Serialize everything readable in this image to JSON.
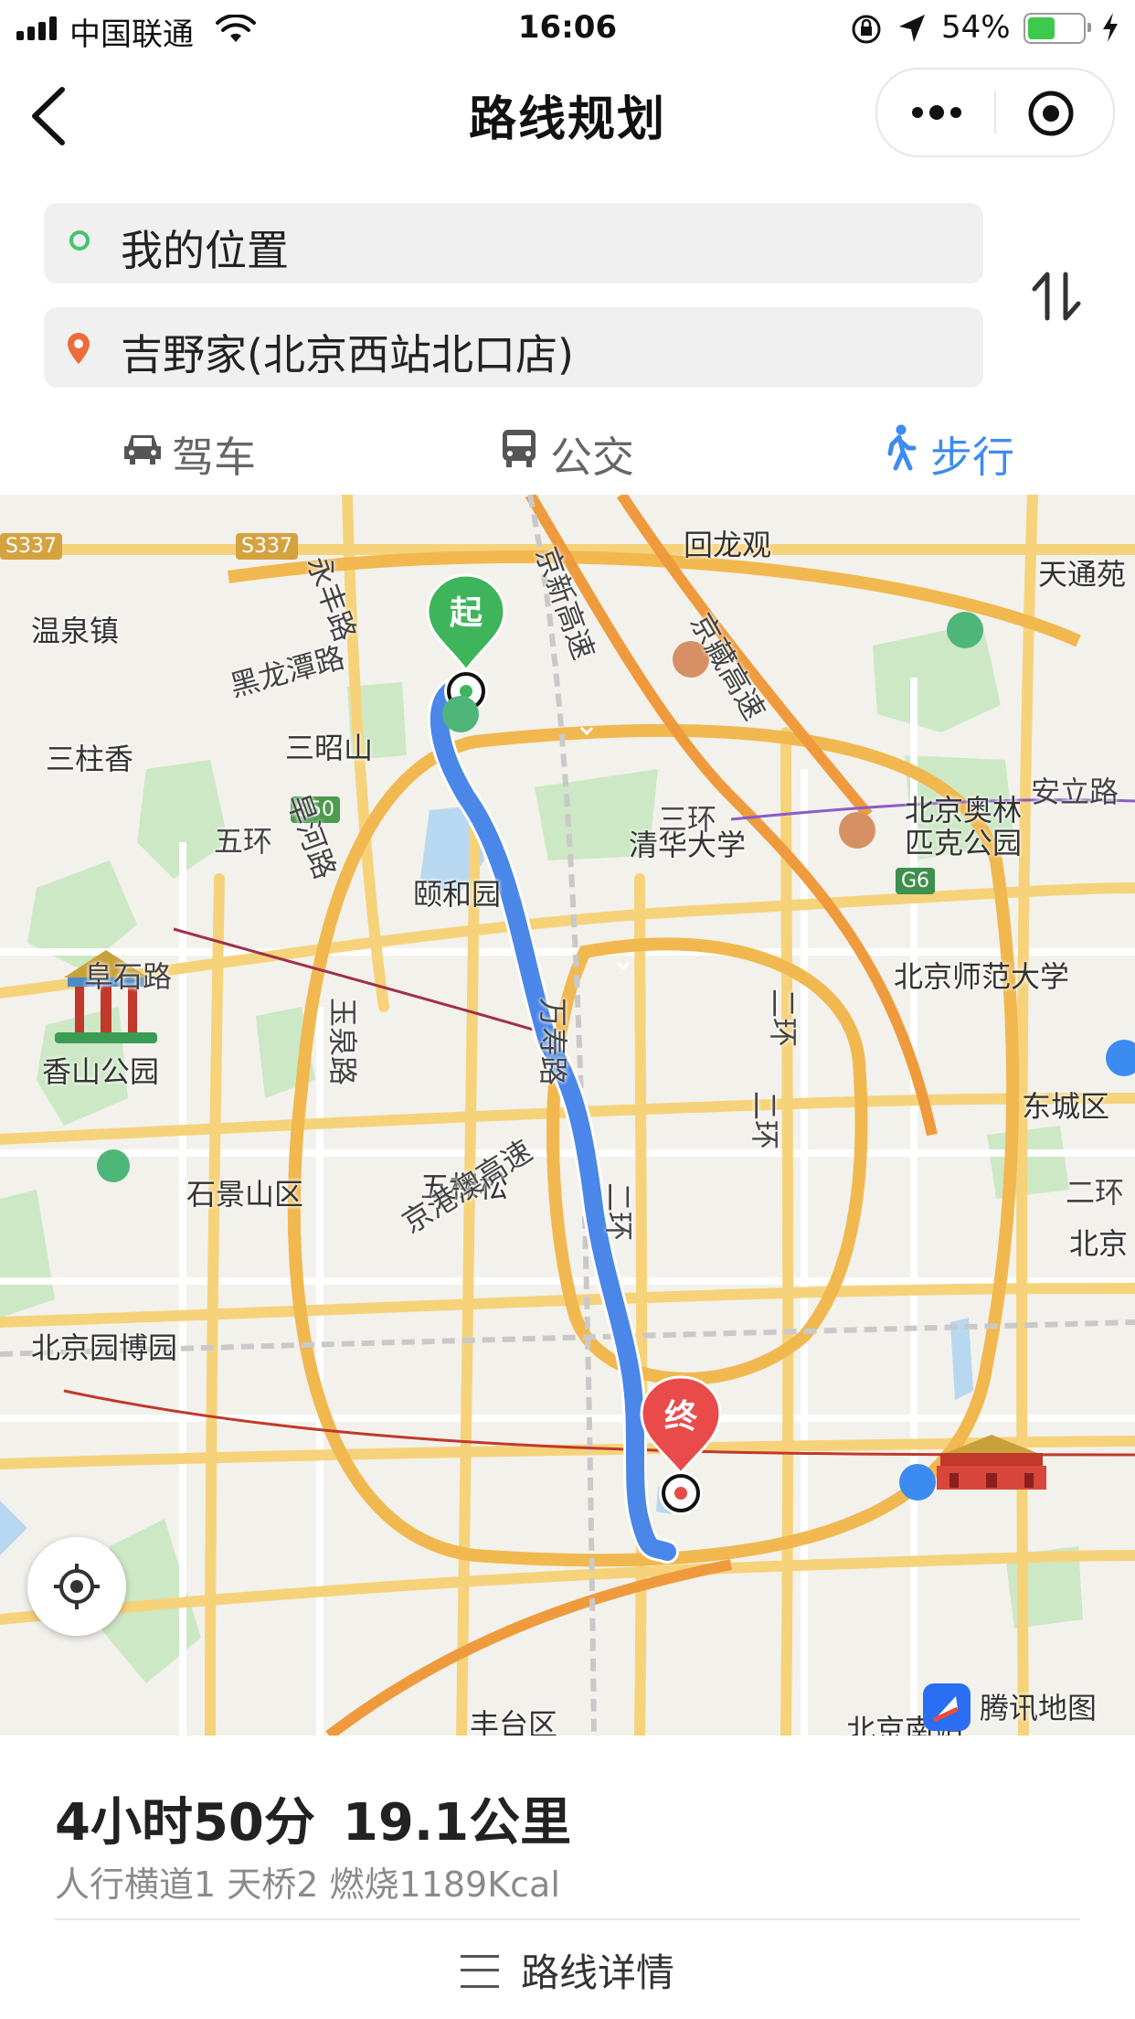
{
  "status_bar": {
    "carrier": "中国联通",
    "time": "16:06",
    "battery": "54%",
    "battery_level": 0.54
  },
  "nav": {
    "title": "路线规划"
  },
  "search": {
    "origin": "我的位置",
    "destination": "吉野家(北京西站北口店)"
  },
  "tabs": [
    {
      "label": "驾车",
      "icon": "car-icon",
      "active": false
    },
    {
      "label": "公交",
      "icon": "bus-icon",
      "active": false
    },
    {
      "label": "步行",
      "icon": "walk-icon",
      "active": true
    }
  ],
  "map": {
    "start_marker": "起",
    "end_marker": "终",
    "shields": [
      "S337",
      "S337",
      "S50",
      "G6"
    ],
    "places": [
      "回龙观",
      "天通苑",
      "温泉镇",
      "三柱香",
      "三昭山",
      "清华大学",
      "北京奥林",
      "匹克公园",
      "颐和园",
      "香山公园",
      "北京师范大学",
      "东城区",
      "石景山区",
      "五棵松",
      "北京",
      "北京园博园",
      "丰台区",
      "北京南站"
    ],
    "roads": [
      "永丰路",
      "黑龙潭路",
      "京新高速",
      "京藏高速",
      "安立路",
      "三环",
      "五环",
      "旱河路",
      "阜石路",
      "玉泉路",
      "万寿路",
      "二环",
      "京港澳高速",
      "二环",
      "二环",
      "二环"
    ],
    "brand": "腾讯地图"
  },
  "route": {
    "duration": "4小时50分",
    "distance": "19.1公里",
    "details": "人行横道1 天桥2 燃烧1189Kcal",
    "details_label": "路线详情"
  },
  "colors": {
    "accent": "#3c8bf0",
    "route": "#4a87e8",
    "start": "#44c466",
    "end": "#e94b4b"
  }
}
